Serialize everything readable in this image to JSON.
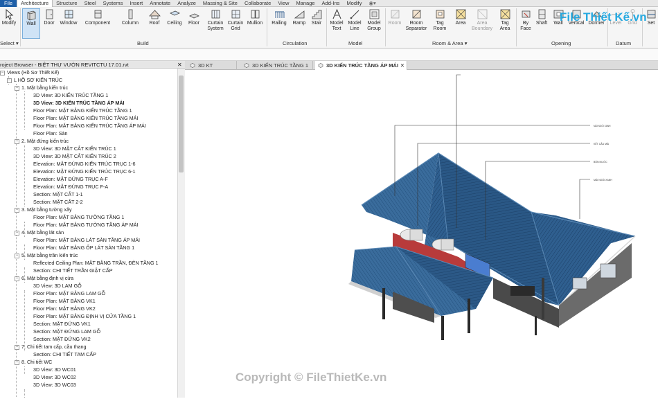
{
  "menu": [
    "File",
    "Architecture",
    "Structure",
    "Steel",
    "Systems",
    "Insert",
    "Annotate",
    "Analyze",
    "Massing & Site",
    "Collaborate",
    "View",
    "Manage",
    "Add-Ins",
    "Modify"
  ],
  "ribbon": {
    "select_label": "Select",
    "modify": "Modify",
    "build": {
      "label": "Build",
      "tools": [
        "Wall",
        "Door",
        "Window",
        "Component",
        "Column",
        "Roof",
        "Ceiling",
        "Floor",
        "Curtain System",
        "Curtain Grid",
        "Mullion"
      ]
    },
    "circulation": {
      "label": "Circulation",
      "tools": [
        "Railing",
        "Ramp",
        "Stair"
      ]
    },
    "model": {
      "label": "Model",
      "tools": [
        "Model Text",
        "Model Line",
        "Model Group"
      ]
    },
    "room_area": {
      "label": "Room & Area",
      "tools": [
        "Room",
        "Room Separator",
        "Tag Room",
        "Area",
        "Area Boundary",
        "Tag Area"
      ]
    },
    "opening": {
      "label": "Opening",
      "tools": [
        "By Face",
        "Shaft",
        "Wall",
        "Vertical",
        "Dormer"
      ]
    },
    "datum": {
      "label": "Datum",
      "tools": [
        "Level",
        "Grid"
      ]
    },
    "set": "Set"
  },
  "browser": {
    "title": "roject Browser - BIỆT THỰ VƯỜN REVITCTU 17.01.rvt",
    "items": [
      "Views (Hồ Sơ Thiết Kế)",
      "L HỒ SƠ KIẾN TRÚC",
      "1. Mặt bằng kiến trúc",
      "3D View: 3D KIẾN TRÚC TẦNG 1",
      "3D View: 3D KIẾN TRÚC TẦNG ÁP MÁI",
      "Floor Plan: MẶT BẰNG KIẾN TRÚC TẦNG 1",
      "Floor Plan: MẶT BẰNG KIẾN TRÚC TẦNG MÁI",
      "Floor Plan: MẶT BẰNG KIẾN TRÚC TẦNG ÁP MÁI",
      "Floor Plan: Sàn",
      "2. Mặt đứng kiến trúc",
      "3D View: 3D MẶT CẮT KIẾN TRÚC 1",
      "3D View: 3D MẶT CẮT KIẾN TRÚC 2",
      "Elevation: MẶT ĐỨNG KIẾN TRÚC TRỤC 1-6",
      "Elevation: MẶT ĐỨNG KIẾN TRÚC TRỤC 6-1",
      "Elevation: MẶT ĐỨNG TRỤC A-F",
      "Elevation: MẶT ĐỨNG TRỤC F-A",
      "Section: MẶT CẮT 1-1",
      "Section: MẶT CẮT 2-2",
      "3. Mặt bằng tường xây",
      "Floor Plan: MẶT BẰNG TƯỜNG TẦNG 1",
      "Floor Plan: MẶT BẰNG TƯỜNG TẦNG ÁP MÁI",
      "4. Mặt bằng lát sàn",
      "Floor Plan: MẶT BẰNG LÁT SÀN TẦNG ÁP MÁI",
      "Floor Plan: MẶT BẰNG ỐP LÁT SÀN TẦNG 1",
      "5. Mặt bằng trần kiến trúc",
      "Reflected Ceiling Plan: MẶT BẰNG TRẦN, ĐÈN TẦNG 1",
      "Section: CHI TIẾT TRẦN GIẬT CẤP",
      "6. Mặt bằng định vị cửa",
      "3D View: 3D LAM GỖ",
      "Floor Plan: MẶT BẰNG LAM GỖ",
      "Floor Plan: MẶT BẰNG VK1",
      "Floor Plan: MẶT BẰNG VK2",
      "Floor Plan: MẶT BẰNG ĐỊNH VỊ CỬA TẦNG 1",
      "Section: MẶT ĐỨNG VK1",
      "Section: MẶT ĐỨNG LAM GỖ",
      "Section: MẶT ĐỨNG VK2",
      "7. Chi tiết tam cấp, cầu thang",
      "Section: CHI TIẾT TAM CẤP",
      "8. Chi tiết WC",
      "3D View: 3D WC01",
      "3D View: 3D WC02",
      "3D View: 3D WC03"
    ]
  },
  "tabs": [
    "3D KT",
    "3D KIẾN TRÚC TẦNG 1",
    "3D KIẾN TRÚC TẦNG ÁP MÁI"
  ],
  "watermark_top": "File Thiết Kế.vn",
  "watermark_bottom": "Copyright © FileThietKe.vn",
  "colors": {
    "roof": "#2e5f8f",
    "roof_dark": "#1d4670",
    "wall": "#3a3a3a",
    "accent": "#1e5fa8",
    "watermark": "#26a9e0"
  }
}
